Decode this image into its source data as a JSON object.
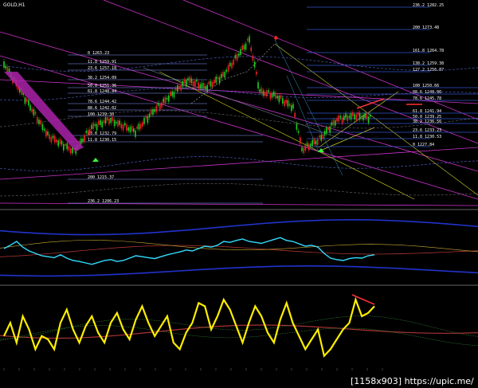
{
  "header": {
    "symbol_label": "GOLD,H1"
  },
  "watermark": {
    "text": "[1158x903] https://upic.me/"
  },
  "colors": {
    "background": "#000000",
    "candle_up": "#22cc22",
    "candle_down": "#ee2222",
    "fib_main": "#3355cc",
    "fib_secondary": "#8899ff",
    "channel": "#cc33cc",
    "pitchfork": "#cccc33",
    "osc1_line": "#33ddff",
    "osc2_line": "#ffee00",
    "divergence": "#ff3333"
  },
  "chart_data": [
    {
      "type": "candlestick",
      "title": "GOLD,H1",
      "fib_levels_upper": [
        {
          "label": "236.2 1282.25"
        },
        {
          "label": "200 1273.48"
        },
        {
          "label": "161.8 1264.78"
        },
        {
          "label": "138.2 1259.38"
        },
        {
          "label": "127.2 1256.87"
        },
        {
          "label": "100 1250.66"
        },
        {
          "label": "88.6 1248.06"
        },
        {
          "label": "78.6 1245.78"
        },
        {
          "label": "61.8 1241.94"
        },
        {
          "label": "50.0 1239.25"
        },
        {
          "label": "38.2 1236.56"
        },
        {
          "label": "23.6 1233.23"
        },
        {
          "label": "11.8 1230.53"
        },
        {
          "label": "0 1227.84"
        }
      ],
      "fib_levels_left": [
        {
          "label": "0 1263.23"
        },
        {
          "label": "11.8 1259.91"
        },
        {
          "label": "23.6 1257.18"
        },
        {
          "label": "38.2 1254.09"
        },
        {
          "label": "50.0 1251.36"
        },
        {
          "label": "61.8 1248.44"
        },
        {
          "label": "78.6 1244.42"
        },
        {
          "label": "88.6 1242.02"
        },
        {
          "label": "100 1239.30"
        },
        {
          "label": "23.6 1232.79"
        },
        {
          "label": "11.8 1230.15"
        },
        {
          "label": "200 1215.37"
        },
        {
          "label": "236.2 1206.23"
        }
      ]
    },
    {
      "type": "line",
      "series": [
        {
          "values": [
            0.55,
            0.62,
            0.7,
            0.58,
            0.5,
            0.45,
            0.4,
            0.38,
            0.36,
            0.42,
            0.35,
            0.3,
            0.28,
            0.25,
            0.22,
            0.26,
            0.3,
            0.32,
            0.28,
            0.3,
            0.35,
            0.4,
            0.38,
            0.36,
            0.34,
            0.38,
            0.42,
            0.45,
            0.48,
            0.52,
            0.5,
            0.55,
            0.6,
            0.58,
            0.62,
            0.7,
            0.68,
            0.72,
            0.75,
            0.7,
            0.68,
            0.66,
            0.7,
            0.74,
            0.78,
            0.72,
            0.7,
            0.65,
            0.6,
            0.62,
            0.58,
            0.45,
            0.35,
            0.32,
            0.3,
            0.34,
            0.36,
            0.35,
            0.4,
            0.42
          ]
        }
      ]
    },
    {
      "type": "line",
      "series": [
        {
          "values": [
            0.4,
            0.6,
            0.3,
            0.7,
            0.5,
            0.2,
            0.4,
            0.35,
            0.2,
            0.6,
            0.8,
            0.5,
            0.3,
            0.55,
            0.7,
            0.45,
            0.3,
            0.6,
            0.75,
            0.5,
            0.35,
            0.65,
            0.85,
            0.6,
            0.4,
            0.55,
            0.7,
            0.3,
            0.2,
            0.45,
            0.6,
            0.9,
            0.85,
            0.5,
            0.7,
            0.95,
            0.8,
            0.55,
            0.3,
            0.6,
            0.85,
            0.7,
            0.45,
            0.3,
            0.65,
            0.9,
            0.6,
            0.4,
            0.2,
            0.35,
            0.5,
            0.1,
            0.2,
            0.35,
            0.5,
            0.6,
            0.95,
            0.7,
            0.75,
            0.85
          ]
        }
      ]
    }
  ]
}
